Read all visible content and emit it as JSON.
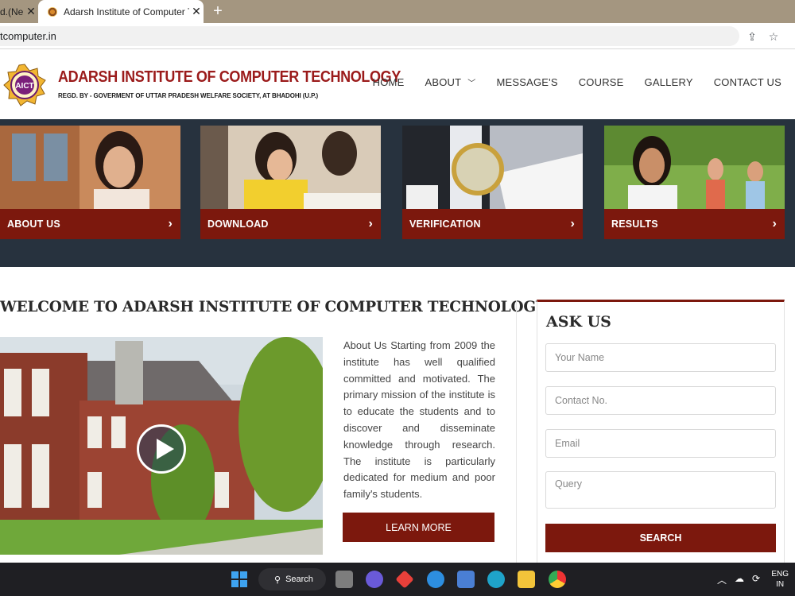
{
  "browser": {
    "tabs": [
      {
        "title": "d.(Ne",
        "active": false
      },
      {
        "title": "Adarsh Institute of Computer Tec",
        "active": true
      }
    ],
    "new_tab": "+",
    "close": "✕",
    "url": "tcomputer.in"
  },
  "header": {
    "logo_text": "AICT",
    "title": "ADARSH INSTITUTE OF COMPUTER TECHNOLOGY",
    "subtitle": "REGD. BY - GOVERMENT OF UTTAR PRADESH WELFARE SOCIETY, AT BHADOHI (U.P.)",
    "nav": {
      "home": "HOME",
      "about": "ABOUT",
      "messages": "MESSAGE'S",
      "course": "COURSE",
      "gallery": "GALLERY",
      "contact": "CONTACT US"
    }
  },
  "feature_cards": [
    {
      "label": "ABOUT US"
    },
    {
      "label": "DOWNLOAD"
    },
    {
      "label": "VERIFICATION"
    },
    {
      "label": "RESULTS"
    }
  ],
  "welcome": {
    "heading": "WELCOME TO ADARSH INSTITUTE OF COMPUTER TECHNOLOGY",
    "body": "About Us Starting from 2009 the institute has well qualified committed and motivated. The primary mission of the institute is to educate the students and to discover and disseminate knowledge through research. The institute is particularly dedicated for medium and poor family's students.",
    "button": "LEARN MORE"
  },
  "ask_us": {
    "heading": "ASK US",
    "name_placeholder": "Your Name",
    "contact_placeholder": "Contact No.",
    "email_placeholder": "Email",
    "query_placeholder": "Query",
    "button": "SEARCH"
  },
  "taskbar": {
    "search": "Search",
    "lang_line1": "ENG",
    "lang_line2": "IN"
  },
  "colors": {
    "brand_red": "#7c180d",
    "band_dark": "#27323e"
  }
}
